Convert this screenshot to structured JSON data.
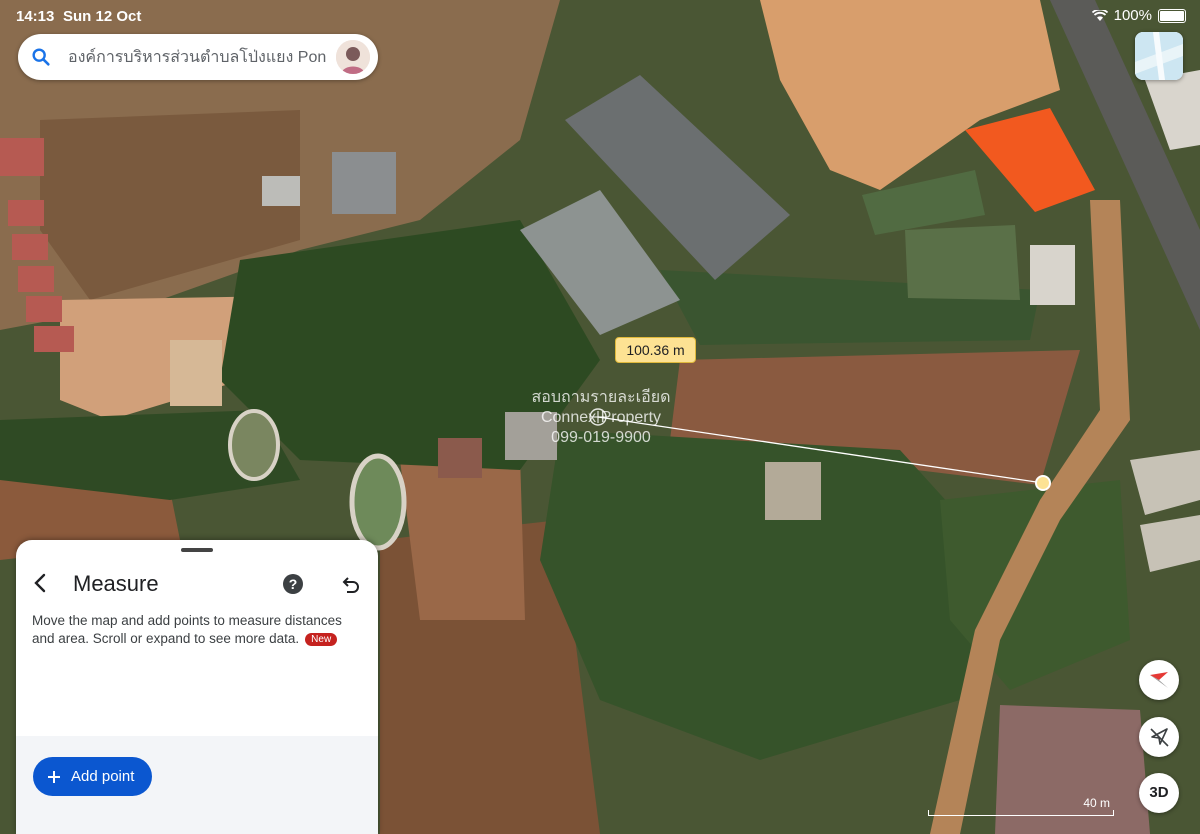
{
  "status_bar": {
    "time": "14:13",
    "date": "Sun 12 Oct",
    "wifi_icon": "wifi-icon",
    "battery": "100%"
  },
  "search": {
    "query": "องค์การบริหารส่วนตำบลโป่งแยง Pong",
    "icon": "search-icon"
  },
  "map": {
    "distance_label": "100.36 m",
    "watermark": {
      "line1": "สอบถามรายละเอียด",
      "line2": "Connex Property",
      "line3": "099-019-9900"
    },
    "scale_label": "40 m",
    "colors": {
      "measure_line": "#ffffff",
      "measure_point": "#fde293",
      "roof_accent": "#f2591f"
    }
  },
  "measure_panel": {
    "title": "Measure",
    "description": "Move the map and add points to measure distances and area. Scroll or expand to see more data.",
    "badge": "New",
    "add_point_label": "Add point",
    "accent": "#0b57d0"
  },
  "map_controls": {
    "three_d_label": "3D"
  }
}
